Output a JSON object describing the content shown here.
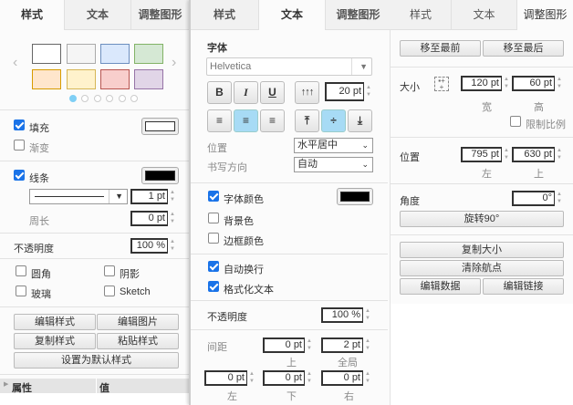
{
  "tabs": {
    "style": "样式",
    "text": "文本",
    "arrange": "调整图形"
  },
  "style_panel": {
    "swatches": [
      {
        "fill": "#ffffff",
        "stroke": "#666666"
      },
      {
        "fill": "#f5f5f5",
        "stroke": "#aaaaaa"
      },
      {
        "fill": "#dae8fc",
        "stroke": "#6c8ebf"
      },
      {
        "fill": "#d5e8d4",
        "stroke": "#82b366"
      },
      {
        "fill": "#ffe6cc",
        "stroke": "#d79b00"
      },
      {
        "fill": "#fff2cc",
        "stroke": "#d6b656"
      },
      {
        "fill": "#f8cecc",
        "stroke": "#b85450"
      },
      {
        "fill": "#e1d5e7",
        "stroke": "#9673a6"
      }
    ],
    "fill_label": "填充",
    "fill_color": "#ffffff",
    "gradient_label": "渐变",
    "line_label": "线条",
    "line_color": "#000000",
    "line_width": "1 pt",
    "perimeter_label": "周长",
    "perimeter_value": "0 pt",
    "opacity_label": "不透明度",
    "opacity_value": "100 %",
    "rounded_label": "圆角",
    "shadow_label": "阴影",
    "glass_label": "玻璃",
    "sketch_label": "Sketch",
    "edit_style": "编辑样式",
    "edit_image": "编辑图片",
    "copy_style": "复制样式",
    "paste_style": "粘贴样式",
    "set_default": "设置为默认样式",
    "prop_header": "属性",
    "value_header": "值"
  },
  "text_panel": {
    "font_label": "字体",
    "font_value": "Helvetica",
    "bold": "B",
    "italic": "I",
    "underline": "U",
    "font_size": "20 pt",
    "position_label": "位置",
    "position_value": "水平居中",
    "direction_label": "书写方向",
    "direction_value": "自动",
    "font_color_label": "字体颜色",
    "font_color": "#000000",
    "bg_color_label": "背景色",
    "border_color_label": "边框颜色",
    "word_wrap_label": "自动换行",
    "formatted_text_label": "格式化文本",
    "opacity_label": "不透明度",
    "opacity_value": "100 %",
    "spacing_label": "间距",
    "top_value": "0 pt",
    "top_label": "上",
    "global_value": "2 pt",
    "global_label": "全局",
    "left_value": "0 pt",
    "left_label": "左",
    "bottom_value": "0 pt",
    "bottom_label": "下",
    "right_value": "0 pt",
    "right_label": "右"
  },
  "arrange_panel": {
    "to_front": "移至最前",
    "to_back": "移至最后",
    "size_label": "大小",
    "width_value": "120 pt",
    "width_label": "宽",
    "height_value": "60 pt",
    "height_label": "高",
    "constrain_label": "限制比例",
    "position_label": "位置",
    "left_value": "795 pt",
    "left_label": "左",
    "top_value": "630 pt",
    "top_label": "上",
    "angle_label": "角度",
    "angle_value": "0°",
    "rotate": "旋转90°",
    "copy_size": "复制大小",
    "clear_waypoints": "清除航点",
    "edit_data": "编辑数据",
    "edit_link": "编辑链接"
  }
}
